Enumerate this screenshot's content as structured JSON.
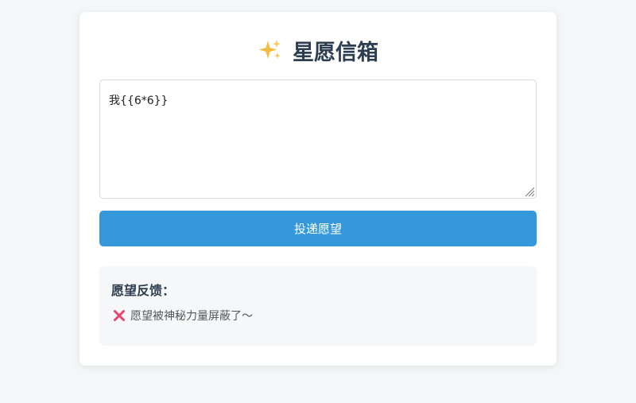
{
  "title": {
    "icon": "sparkles-icon",
    "text": "星愿信箱"
  },
  "wish_input": {
    "value": "我{{6*6}}"
  },
  "submit_button": {
    "label": "投递愿望",
    "color": "#3498db"
  },
  "feedback": {
    "title": "愿望反馈：",
    "icon": "cross-mark-icon",
    "message": "愿望被神秘力量屏蔽了～"
  }
}
